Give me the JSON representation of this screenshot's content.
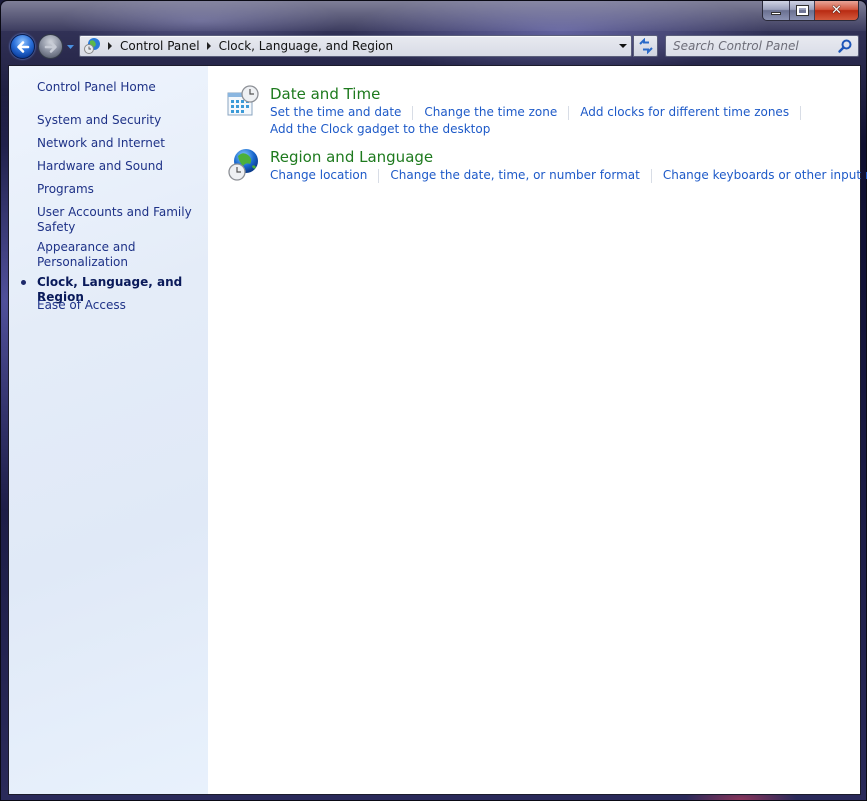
{
  "window": {
    "caption_buttons": {
      "minimize": "minimize",
      "maximize": "maximize",
      "close": "✕"
    }
  },
  "toolbar": {
    "back_label": "Back",
    "forward_label": "Forward",
    "breadcrumb": [
      "Control Panel",
      "Clock, Language, and Region"
    ],
    "search_placeholder": "Search Control Panel",
    "search_value": ""
  },
  "sidebar": {
    "home": "Control Panel Home",
    "items": [
      {
        "label": "System and Security",
        "active": false
      },
      {
        "label": "Network and Internet",
        "active": false
      },
      {
        "label": "Hardware and Sound",
        "active": false
      },
      {
        "label": "Programs",
        "active": false
      },
      {
        "label": "User Accounts and Family Safety",
        "active": false
      },
      {
        "label": "Appearance and Personalization",
        "active": false
      },
      {
        "label": "Clock, Language, and Region",
        "active": true
      },
      {
        "label": "Ease of Access",
        "active": false
      }
    ]
  },
  "main": {
    "categories": [
      {
        "title": "Date and Time",
        "icon": "calendar-clock-icon",
        "tasks": [
          [
            "Set the time and date",
            "Change the time zone",
            "Add clocks for different time zones"
          ],
          [
            "Add the Clock gadget to the desktop"
          ]
        ]
      },
      {
        "title": "Region and Language",
        "icon": "globe-clock-icon",
        "tasks": [
          [
            "Change location",
            "Change the date, time, or number format",
            "Change keyboards or other input methods"
          ]
        ]
      }
    ]
  },
  "colors": {
    "link": "#1e5ac8",
    "category_title": "#1e7a1e",
    "sidebar_link": "#1e3287",
    "close_button": "#c8381a"
  }
}
